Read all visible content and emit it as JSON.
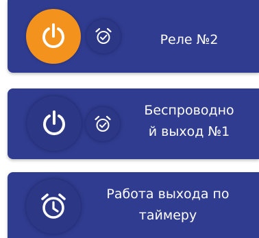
{
  "colors": {
    "card_background": "#303c8f",
    "button_background": "#2c3786",
    "power_active": "#f3921c",
    "icon": "#ffffff",
    "text": "#ffffff"
  },
  "items": [
    {
      "label": "Реле №2",
      "power_state": "on",
      "power_icon": "power-icon",
      "timer_icon": "alarm-clock-check-icon"
    },
    {
      "label": "Беспроводно\nй выход №1",
      "power_state": "off",
      "power_icon": "power-icon",
      "timer_icon": "alarm-clock-check-icon"
    },
    {
      "label": "Работа выхода по\nтаймеру",
      "timer_icon": "alarm-clock-icon"
    }
  ]
}
